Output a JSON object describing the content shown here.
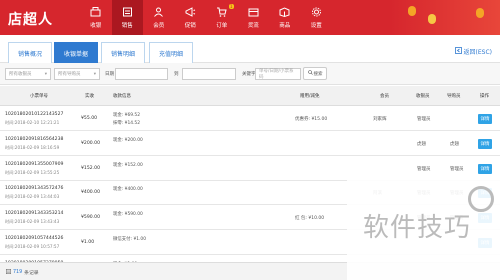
{
  "app": {
    "logo": "店超人"
  },
  "nav": [
    {
      "label": "收银",
      "icon": "cashier-icon"
    },
    {
      "label": "销售",
      "icon": "sales-icon",
      "active": true
    },
    {
      "label": "会员",
      "icon": "member-icon"
    },
    {
      "label": "促销",
      "icon": "promotion-icon"
    },
    {
      "label": "订单",
      "icon": "order-icon",
      "badge": "1"
    },
    {
      "label": "货流",
      "icon": "logistics-icon"
    },
    {
      "label": "商品",
      "icon": "goods-icon"
    },
    {
      "label": "设置",
      "icon": "settings-icon"
    }
  ],
  "tabs": [
    {
      "label": "销售概况"
    },
    {
      "label": "收银单据",
      "active": true
    },
    {
      "label": "销售明细"
    },
    {
      "label": "充值明细"
    }
  ],
  "back_label": "返回(ESC)",
  "filters": {
    "cashier_placeholder": "所有收银员",
    "guide_placeholder": "所有导购员",
    "date_label": "日期",
    "to_label": "到",
    "keyword_label": "关键字",
    "keyword_placeholder": "单号/日期/小票系码",
    "search_label": "搜索"
  },
  "table": {
    "headers": {
      "order_no": "小票单号",
      "amount": "实收",
      "pay_info": "收款信息",
      "discount": "赠用/减免",
      "member": "会员",
      "cashier": "收银员",
      "guide": "导购员",
      "action": "操作"
    },
    "detail_label": "详情",
    "rows": [
      {
        "no": "10201802010122143527",
        "time": "时间:2018-02-10 12:21:21",
        "amount": "¥55.00",
        "pay1": "现金:    ¥69.52",
        "pay2": "抹零:    ¥14.52",
        "discount": "优惠券: ¥15.00",
        "member": "刘家辉",
        "cashier": "管理员",
        "guide": ""
      },
      {
        "no": "10201802091816564238",
        "time": "时间:2018-02-09 18:16:59",
        "amount": "¥200.00",
        "pay1": "现金:    ¥200.00",
        "pay2": "",
        "discount": "",
        "member": "",
        "cashier": "虎翅",
        "guide": "虎翅"
      },
      {
        "no": "10201802091355007909",
        "time": "时间:2018-02-09 13:55:25",
        "amount": "¥152.00",
        "pay1": "现金:    ¥152.00",
        "pay2": "",
        "discount": "",
        "member": "",
        "cashier": "管理员",
        "guide": "管理员"
      },
      {
        "no": "10201802091343572476",
        "time": "时间:2018-02-09 13:44:03",
        "amount": "¥400.00",
        "pay1": "现金:    ¥400.00",
        "pay2": "",
        "discount": "",
        "member": "阿滨",
        "cashier": "管理员",
        "guide": "管理员"
      },
      {
        "no": "10201802091343353214",
        "time": "时间:2018-02-09 13:43:43",
        "amount": "¥590.00",
        "pay1": "现金:    ¥590.00",
        "pay2": "",
        "discount": "红    包: ¥10.00",
        "member": "",
        "cashier": "管理员",
        "guide": "管理员"
      },
      {
        "no": "10201802091057444526",
        "time": "时间:2018-02-09 10:57:57",
        "amount": "¥1.00",
        "pay1": "微信支付:  ¥1.00",
        "pay2": "",
        "discount": "",
        "member": "",
        "cashier": "",
        "guide": ""
      },
      {
        "no": "10201802091057379959",
        "time": "时间:2018-02-09 10:57:40",
        "amount": "¥1.00",
        "pay1": "现金:    ¥1.00",
        "pay2": "",
        "discount": "",
        "member": "",
        "cashier": "",
        "guide": ""
      }
    ]
  },
  "footer": {
    "count": "719",
    "suffix": "条记录"
  },
  "watermark": {
    "text": "软件技巧"
  },
  "colors": {
    "brand": "#d6262d",
    "accent": "#2f7ad0",
    "detail": "#2fa3e6"
  }
}
